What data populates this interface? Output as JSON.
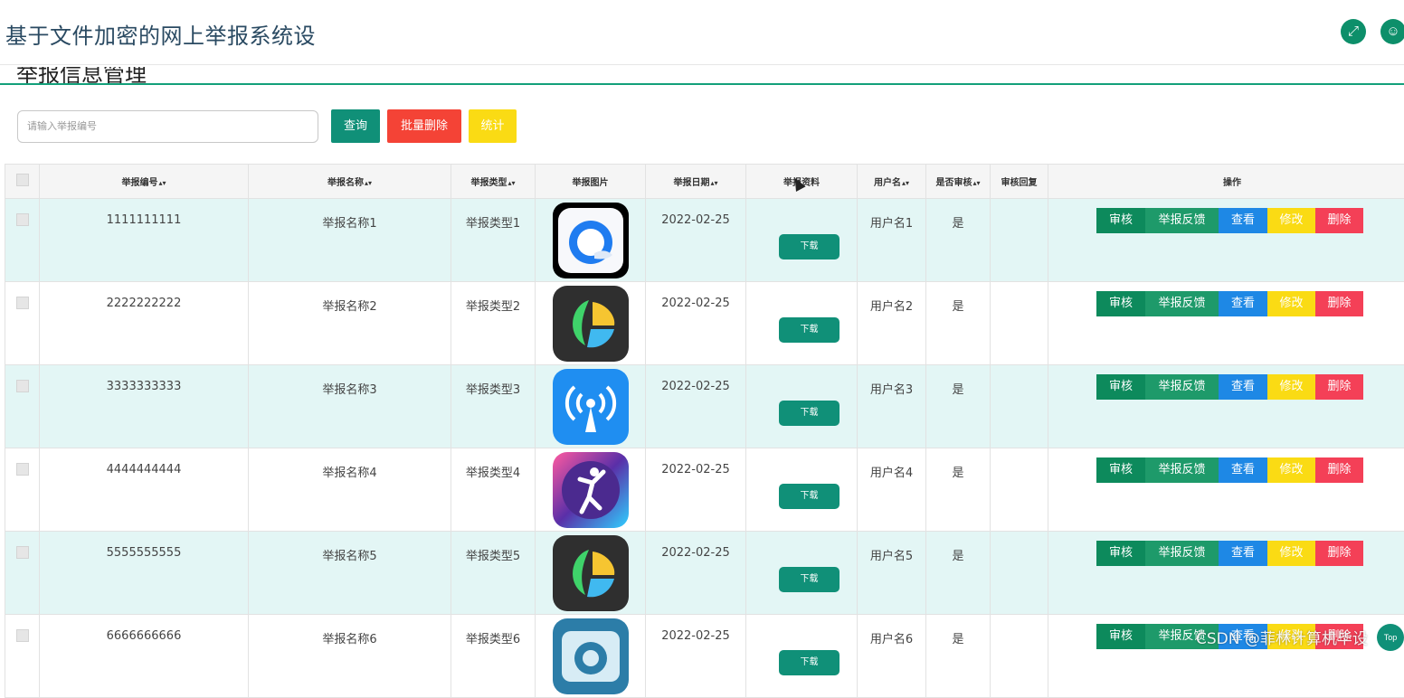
{
  "app": {
    "title": "基于文件加密的网上举报系统设"
  },
  "header_icons": {
    "expand": "expand-icon",
    "user": "user-icon"
  },
  "page": {
    "heading": "举报信息管理"
  },
  "search": {
    "placeholder": "请输入举报编号"
  },
  "toolbar": {
    "query_label": "查询",
    "batch_delete_label": "批量删除",
    "stats_label": "统计"
  },
  "table": {
    "columns": [
      "举报编号",
      "举报名称",
      "举报类型",
      "举报图片",
      "举报日期",
      "举报资料",
      "用户名",
      "是否审核",
      "审核回复",
      "操作"
    ],
    "download_label": "下载",
    "actions": {
      "audit": "审核",
      "feedback": "举报反馈",
      "view": "查看",
      "edit": "修改",
      "delete": "删除"
    },
    "rows": [
      {
        "id": "1111111111",
        "name": "举报名称1",
        "type": "举报类型1",
        "image": "qq-browser-icon",
        "date": "2022-02-25",
        "user": "用户名1",
        "audited": "是",
        "reply": ""
      },
      {
        "id": "2222222222",
        "name": "举报名称2",
        "type": "举报类型2",
        "image": "leaf-app-icon",
        "date": "2022-02-25",
        "user": "用户名2",
        "audited": "是",
        "reply": ""
      },
      {
        "id": "3333333333",
        "name": "举报名称3",
        "type": "举报类型3",
        "image": "wifi-signal-icon",
        "date": "2022-02-25",
        "user": "用户名3",
        "audited": "是",
        "reply": ""
      },
      {
        "id": "4444444444",
        "name": "举报名称4",
        "type": "举报类型4",
        "image": "dancer-app-icon",
        "date": "2022-02-25",
        "user": "用户名4",
        "audited": "是",
        "reply": ""
      },
      {
        "id": "5555555555",
        "name": "举报名称5",
        "type": "举报类型5",
        "image": "leaf-app-icon",
        "date": "2022-02-25",
        "user": "用户名5",
        "audited": "是",
        "reply": ""
      },
      {
        "id": "6666666666",
        "name": "举报名称6",
        "type": "举报类型6",
        "image": "camera-app-icon",
        "date": "2022-02-25",
        "user": "用户名6",
        "audited": "是",
        "reply": ""
      }
    ]
  },
  "watermark": "CSDN @菲林计算机毕设",
  "back_to_top": "Top"
}
